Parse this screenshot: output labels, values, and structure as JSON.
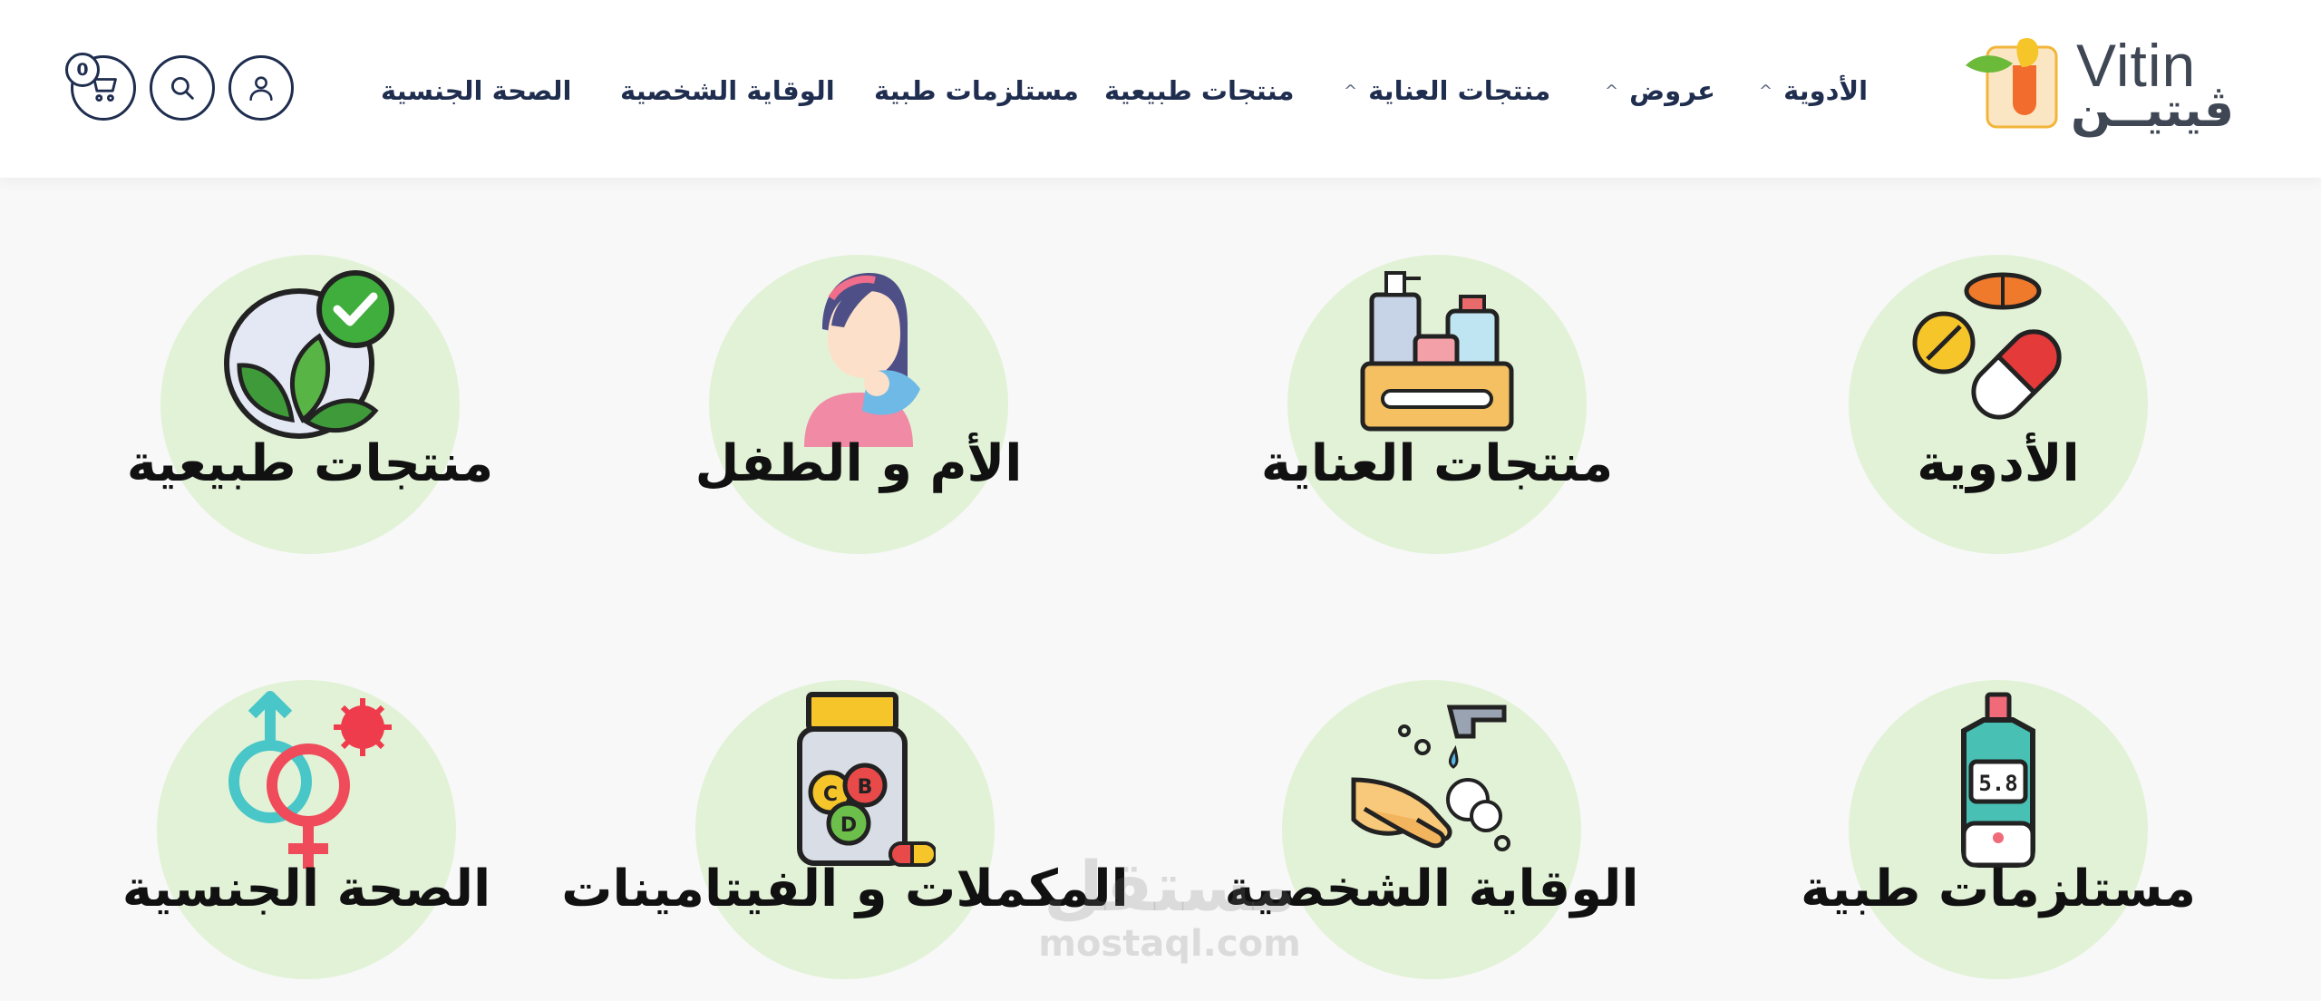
{
  "header": {
    "logo": {
      "latin": "Vitin",
      "arabic": "ڤيتيــن"
    },
    "cart_count": "0",
    "nav": [
      {
        "label": "الأدوية",
        "has_dropdown": true
      },
      {
        "label": "عروض",
        "has_dropdown": true
      },
      {
        "label": "منتجات العناية",
        "has_dropdown": true
      },
      {
        "label": "منتجات طبيعية",
        "has_dropdown": false
      },
      {
        "label": "مستلزمات طبية",
        "has_dropdown": false
      },
      {
        "label": "الوقاية الشخصية",
        "has_dropdown": false
      },
      {
        "label": "الصحة الجنسية",
        "has_dropdown": false
      }
    ],
    "icons": [
      "user-icon",
      "search-icon",
      "cart-icon"
    ],
    "chevron": "^"
  },
  "categories": [
    {
      "label": "الأدوية",
      "icon": "capsule-pills-icon"
    },
    {
      "label": "منتجات العناية",
      "icon": "care-products-box-icon"
    },
    {
      "label": "الأم و الطفل",
      "icon": "mother-child-icon"
    },
    {
      "label": "منتجات طبيعية",
      "icon": "natural-leaves-check-icon"
    },
    {
      "label": "مستلزمات طبية",
      "icon": "glucose-meter-icon"
    },
    {
      "label": "الوقاية الشخصية",
      "icon": "hand-washing-icon"
    },
    {
      "label": "المكملات و الفيتامينات",
      "icon": "vitamins-jar-icon"
    },
    {
      "label": "الصحة الجنسية",
      "icon": "gender-symbols-icon"
    }
  ],
  "watermark": {
    "arabic": "مستقل",
    "latin": "mostaql.com"
  },
  "colors": {
    "nav_text": "#1f2d4f",
    "circle_bg": "#e2f2d7",
    "page_bg": "#f8f8f8",
    "label_text": "#111111"
  }
}
